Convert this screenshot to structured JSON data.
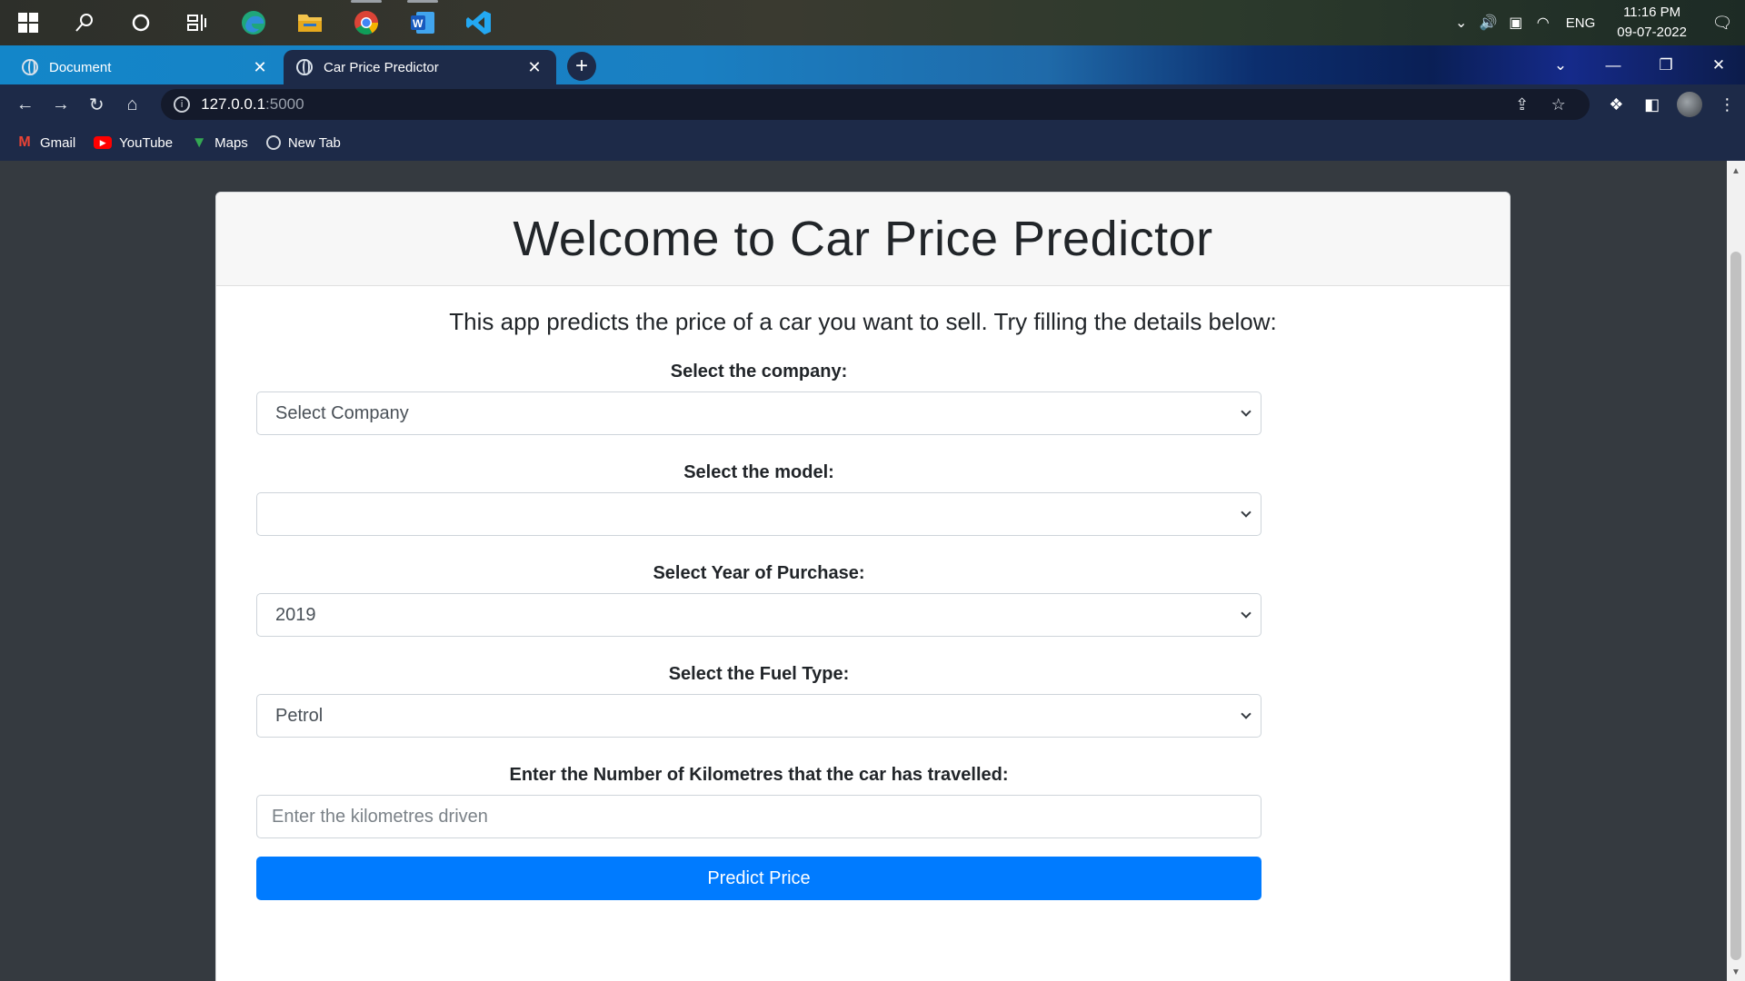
{
  "taskbar": {
    "apps": [
      "windows-start",
      "search",
      "cortana",
      "task-view",
      "edge",
      "file-explorer",
      "chrome",
      "word",
      "vscode"
    ],
    "language": "ENG",
    "time": "11:16 PM",
    "date": "09-07-2022"
  },
  "browser": {
    "tabs": [
      {
        "title": "Document",
        "active": false
      },
      {
        "title": "Car Price Predictor",
        "active": true
      }
    ],
    "url_host": "127.0.0.1",
    "url_port": ":5000",
    "bookmarks": [
      "Gmail",
      "YouTube",
      "Maps",
      "New Tab"
    ]
  },
  "page": {
    "heading": "Welcome to Car Price Predictor",
    "lead": "This app predicts the price of a car you want to sell. Try filling the details below:",
    "company_label": "Select the company:",
    "company_value": "Select Company",
    "model_label": "Select the model:",
    "model_value": "",
    "year_label": "Select Year of Purchase:",
    "year_value": "2019",
    "fuel_label": "Select the Fuel Type:",
    "fuel_value": "Petrol",
    "km_label": "Enter the Number of Kilometres that the car has travelled:",
    "km_placeholder": "Enter the kilometres driven",
    "predict_button": "Predict Price"
  },
  "colors": {
    "primary_button": "#007bff",
    "page_background": "#353a40",
    "card_header": "#f7f7f7"
  }
}
